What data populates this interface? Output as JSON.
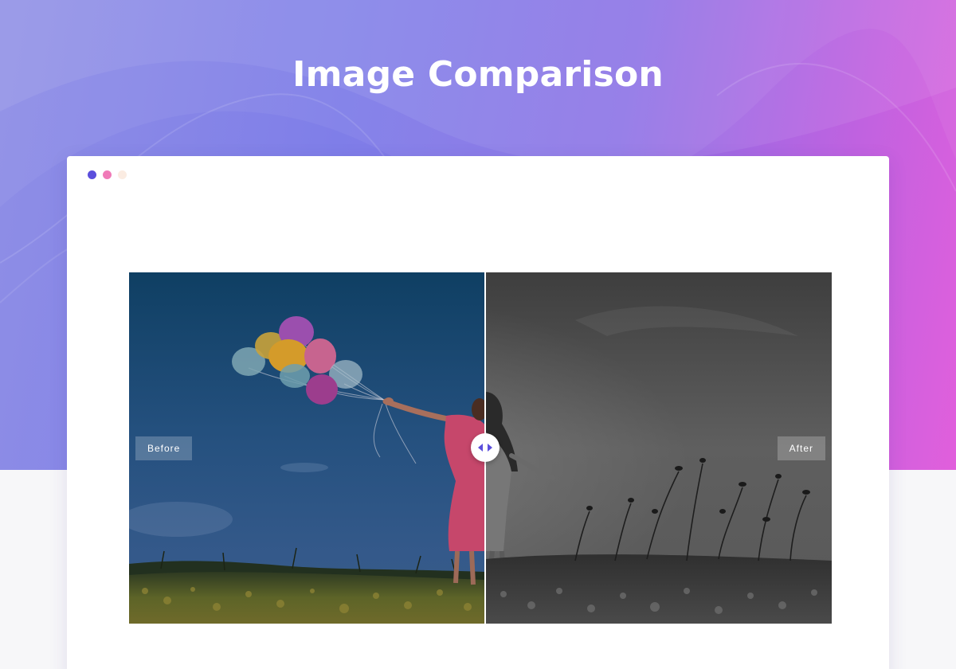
{
  "header": {
    "title": "Image Comparison"
  },
  "window": {
    "controls": [
      {
        "name": "close",
        "color": "#5b4fdc"
      },
      {
        "name": "minimize",
        "color": "#f07ab8"
      },
      {
        "name": "maximize",
        "color": "#fbece2"
      }
    ]
  },
  "comparison": {
    "before_label": "Before",
    "after_label": "After",
    "slider_position": 0.506,
    "handle_icon": "left-right-arrows-icon",
    "before_image": "woman-with-balloons-color",
    "after_image": "woman-in-field-grayscale"
  },
  "colors": {
    "gradient_start": "#8f8fe6",
    "gradient_end": "#e15fdc",
    "handle_arrow": "#5b4fdc"
  }
}
